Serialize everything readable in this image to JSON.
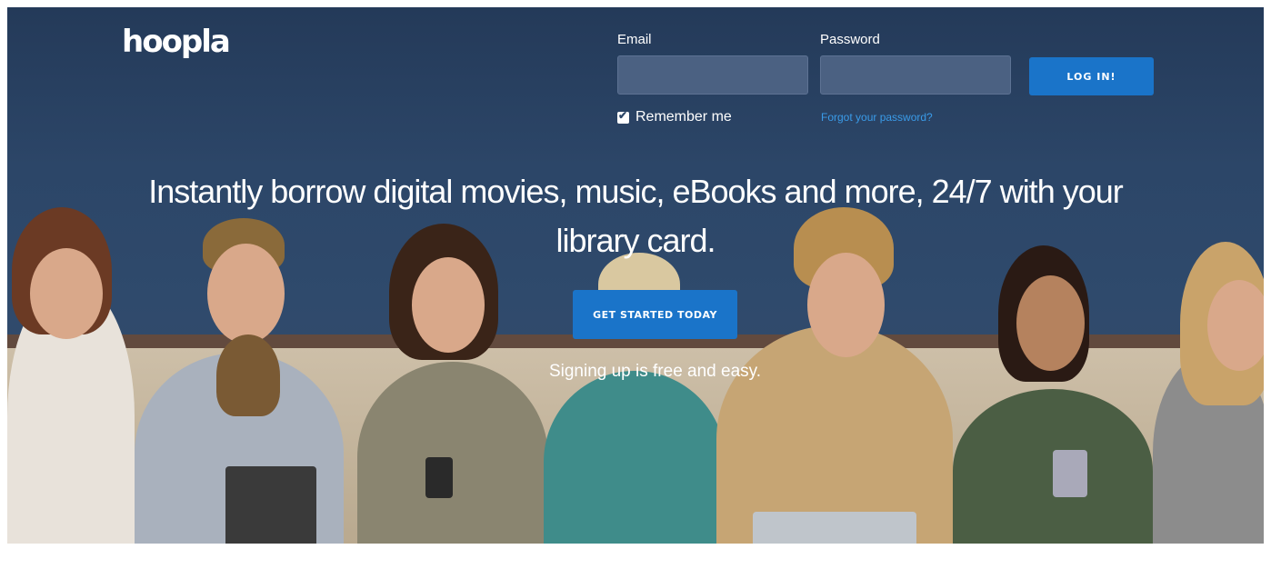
{
  "brand": {
    "logo_text": "hoopla"
  },
  "login": {
    "email_label": "Email",
    "password_label": "Password",
    "email_value": "",
    "password_value": "",
    "login_button": "LOG IN!",
    "remember_label": "Remember me",
    "remember_checked": true,
    "forgot_link": "Forgot your password?"
  },
  "hero": {
    "headline_line1": "Instantly borrow digital movies, music, eBooks and more, 24/7 with your",
    "headline_line2": "library card.",
    "cta_button": "GET STARTED TODAY",
    "subtext": "Signing up is free and easy."
  },
  "colors": {
    "primary_button": "#1a74c9",
    "link": "#3a9be8",
    "hero_bg": "#2c4668"
  }
}
